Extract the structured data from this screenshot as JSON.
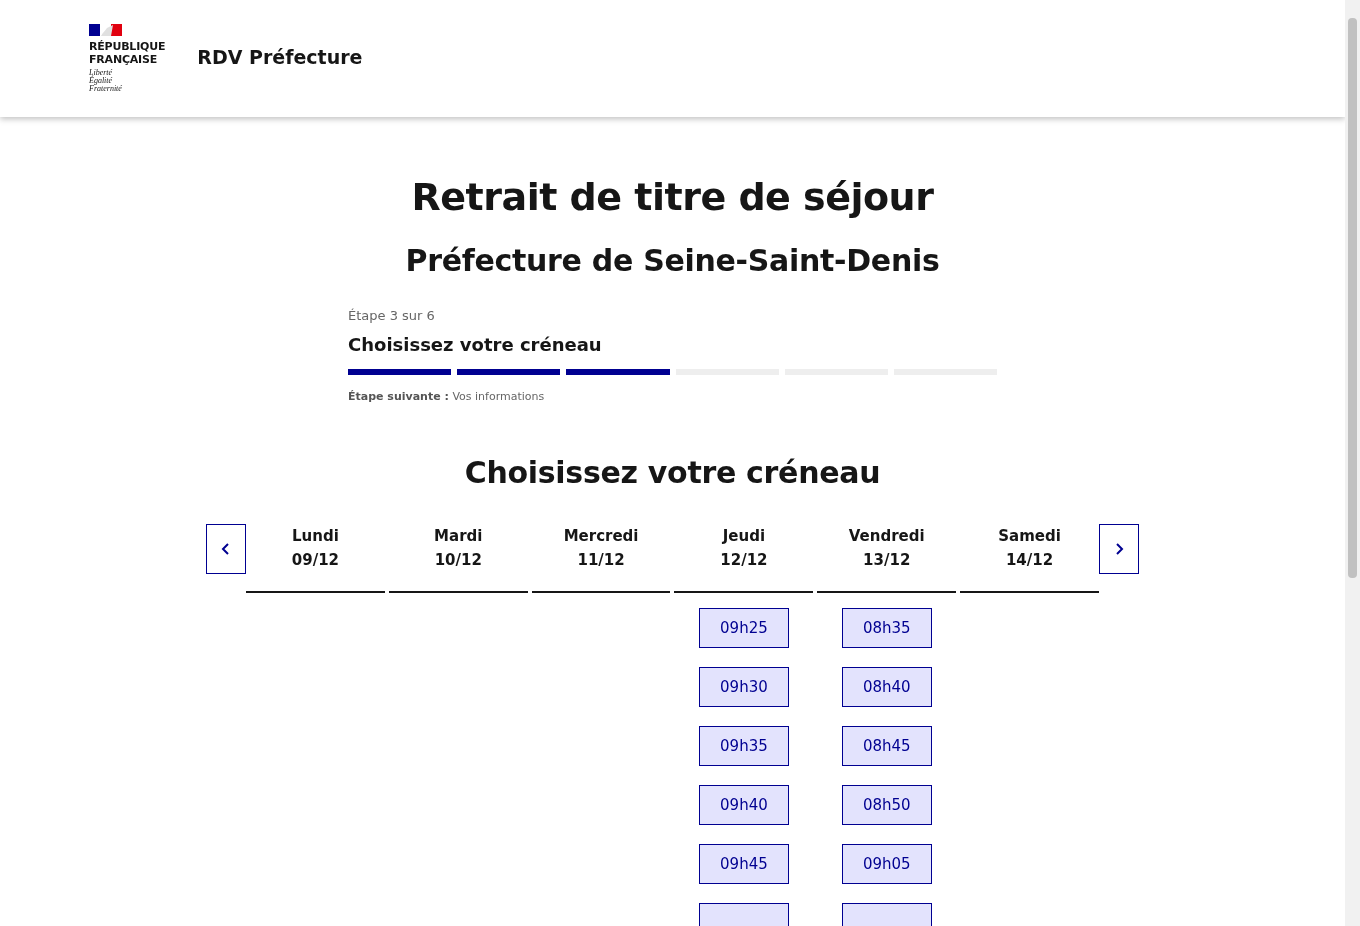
{
  "header": {
    "logo_lines": [
      "RÉPUBLIQUE",
      "FRANÇAISE"
    ],
    "motto": [
      "Liberté",
      "Égalité",
      "Fraternité"
    ],
    "site_title": "RDV Préfecture"
  },
  "page_title": "Retrait de titre de séjour",
  "subtitle": "Préfecture de Seine-Saint-Denis",
  "stepper": {
    "count": "Étape 3 sur 6",
    "title": "Choisissez votre créneau",
    "segments": [
      {
        "done": true
      },
      {
        "done": true
      },
      {
        "done": true
      },
      {
        "done": false
      },
      {
        "done": false
      },
      {
        "done": false
      }
    ],
    "next_label": "Étape suivante :",
    "next_value": "Vos informations"
  },
  "calendar": {
    "title": "Choisissez votre créneau",
    "days": [
      {
        "name": "Lundi",
        "date": "09/12"
      },
      {
        "name": "Mardi",
        "date": "10/12"
      },
      {
        "name": "Mercredi",
        "date": "11/12"
      },
      {
        "name": "Jeudi",
        "date": "12/12",
        "slots": [
          "09h25",
          "09h30",
          "09h35",
          "09h40",
          "09h45"
        ],
        "more_below": true
      },
      {
        "name": "Vendredi",
        "date": "13/12",
        "slots": [
          "08h35",
          "08h40",
          "08h45",
          "08h50",
          "09h05"
        ],
        "more_below": true
      },
      {
        "name": "Samedi",
        "date": "14/12"
      }
    ]
  }
}
